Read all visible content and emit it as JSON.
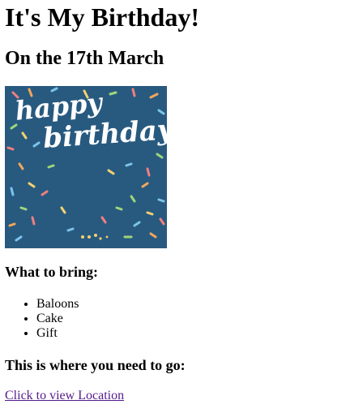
{
  "page": {
    "title": "It's My Birthday!",
    "date": "On the 17th March"
  },
  "card_image": {
    "icon": "happy-birthday-card-image",
    "text_line_1": "happy",
    "text_line_2": "birthday",
    "background_color": "#285a80",
    "text_color": "#ffffff",
    "confetti_colors": [
      "#f2a65a",
      "#7cc5ea",
      "#9fd67a",
      "#f07f7f",
      "#f4d06f"
    ]
  },
  "bring": {
    "heading": "What to bring:",
    "items": [
      "Baloons",
      "Cake",
      "Gift"
    ]
  },
  "location": {
    "heading": "This is where you need to go:",
    "link_text": "Click to view Location",
    "link_color": "#551a8b"
  }
}
